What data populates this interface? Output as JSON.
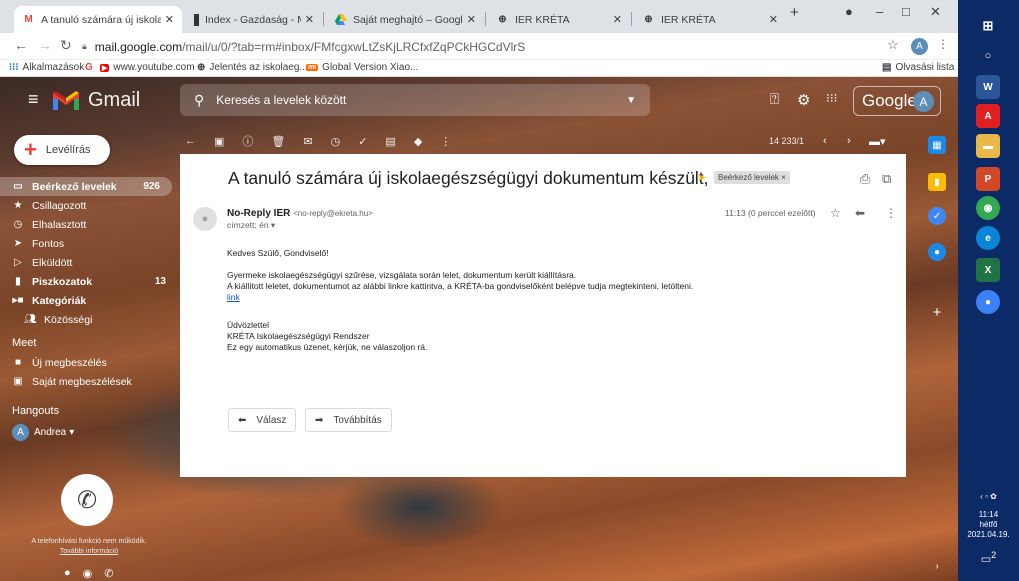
{
  "browser": {
    "tabs": [
      {
        "title": "A tanuló számára új iskolaegész",
        "icon": "gmail-icon",
        "active": true
      },
      {
        "title": "Index - Gazdaság - Magyar taló",
        "icon": "index-icon"
      },
      {
        "title": "Saját meghajtó – Google Drive",
        "icon": "drive-icon"
      },
      {
        "title": "IER KRÉTA",
        "icon": "globe-icon"
      },
      {
        "title": "IER KRÉTA",
        "icon": "globe-icon"
      }
    ],
    "new_tab": "+",
    "url_domain": "mail.google.com",
    "url_rest": "/mail/u/0/?tab=rm#inbox/FMfcgxwLtZsKjLRCfxfZqPCkHGCdVlrS",
    "bookmarks": [
      {
        "label": "Alkalmazások",
        "icon": "apps-icon"
      },
      {
        "label": "",
        "icon": "google-icon"
      },
      {
        "label": "www.youtube.com",
        "icon": "youtube-icon"
      },
      {
        "label": "Jelentés az iskolaeg...",
        "icon": "globe-icon"
      },
      {
        "label": "Global Version Xiao...",
        "icon": "mi-icon"
      }
    ],
    "reading_list": "Olvasási lista",
    "profile_letter": "A"
  },
  "gmail": {
    "logo_text": "Gmail",
    "search_placeholder": "Keresés a levelek között",
    "google_text": "Google",
    "avatar_letter": "A",
    "compose": "Levélírás",
    "nav": [
      {
        "label": "Beérkező levelek",
        "count": "926",
        "icon": "inbox-icon",
        "active": true
      },
      {
        "label": "Csillagozott",
        "count": "",
        "icon": "star-icon"
      },
      {
        "label": "Elhalasztott",
        "count": "",
        "icon": "clock-icon"
      },
      {
        "label": "Fontos",
        "count": "",
        "icon": "important-icon"
      },
      {
        "label": "Elküldött",
        "count": "",
        "icon": "send-icon"
      },
      {
        "label": "Piszkozatok",
        "count": "13",
        "icon": "draft-icon",
        "bold": true
      },
      {
        "label": "Kategóriák",
        "count": "",
        "icon": "label-icon",
        "bold": true
      },
      {
        "label": "Közösségi",
        "count": "",
        "icon": "people-icon"
      }
    ],
    "meet_header": "Meet",
    "meet": [
      {
        "label": "Új megbeszélés",
        "icon": "video-icon"
      },
      {
        "label": "Saját megbeszélések",
        "icon": "calendar-icon"
      }
    ],
    "hangouts_header": "Hangouts",
    "hangouts_user": "Andrea",
    "hangouts_letter": "A",
    "phone_note1": "A telefonhívási funkció nem működik.",
    "phone_note2": "További információ",
    "pagination": "14 233/1"
  },
  "email": {
    "subject": "A tanuló számára új iskolaegészségügyi dokumentum készült, elérhető",
    "label_chip": "Beérkező levelek ×",
    "sender_name": "No-Reply IER",
    "sender_email": "<no-reply@ekreta.hu>",
    "recipient": "címzett: én ▾",
    "time": "11:13 (0 perccel ezelőtt)",
    "greeting": "Kedves Szülő, Gondviselő!",
    "line1": "Gyermeke iskolaegészségügyi szűrése, vizsgálata során lelet, dokumentum került kiállításra.",
    "line2": "A kiállított leletet, dokumentumot az alábbi linkre kattintva, a KRÉTA-ba gondviselőként belépve tudja megtekinteni, letölteni.",
    "link": "link",
    "sign1": "Üdvözlettel",
    "sign2": "KRÉTA Iskolaegészségügyi Rendszer",
    "sign3": "Ez egy automatikus üzenet, kérjük, ne válaszoljon rá.",
    "reply": "Válasz",
    "forward": "Továbbítás"
  },
  "taskbar": {
    "time": "11:14",
    "day": "hétfő",
    "date": "2021.04.19.",
    "notif_count": "2"
  }
}
